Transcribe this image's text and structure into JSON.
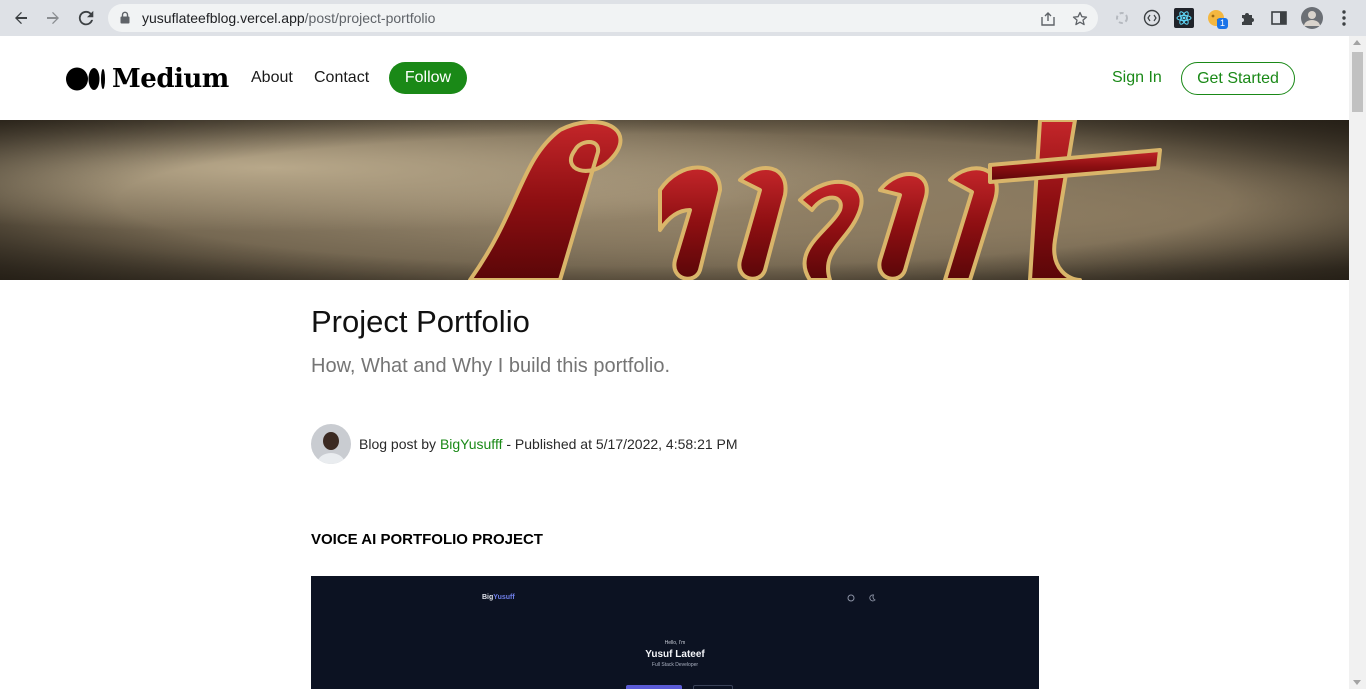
{
  "browser": {
    "url_host": "yusuflateefblog.vercel.app",
    "url_path": "/post/project-portfolio",
    "extension_badge": "1"
  },
  "header": {
    "logo_text": "Medium",
    "nav": [
      {
        "label": "About"
      },
      {
        "label": "Contact"
      }
    ],
    "follow_label": "Follow",
    "signin_label": "Sign In",
    "get_started_label": "Get Started"
  },
  "post": {
    "title": "Project Portfolio",
    "subtitle": "How, What and Why I build this portfolio.",
    "byline_prefix": "Blog post by ",
    "author": "BigYusufff",
    "published": " - Published at 5/17/2022, 4:58:21 PM",
    "section_heading": "VOICE AI PORTFOLIO PROJECT"
  },
  "screenshot_preview": {
    "brand_a": "Big",
    "brand_b": "Yusuff",
    "hello": "Hello, I'm",
    "name": "Yusuf Lateef",
    "role": "Full Stack Developer"
  },
  "colors": {
    "accent_green": "#1a8917",
    "chrome_bg": "#dee1e6",
    "banner_red": "#8e0f12",
    "preview_bg": "#0c1222"
  }
}
